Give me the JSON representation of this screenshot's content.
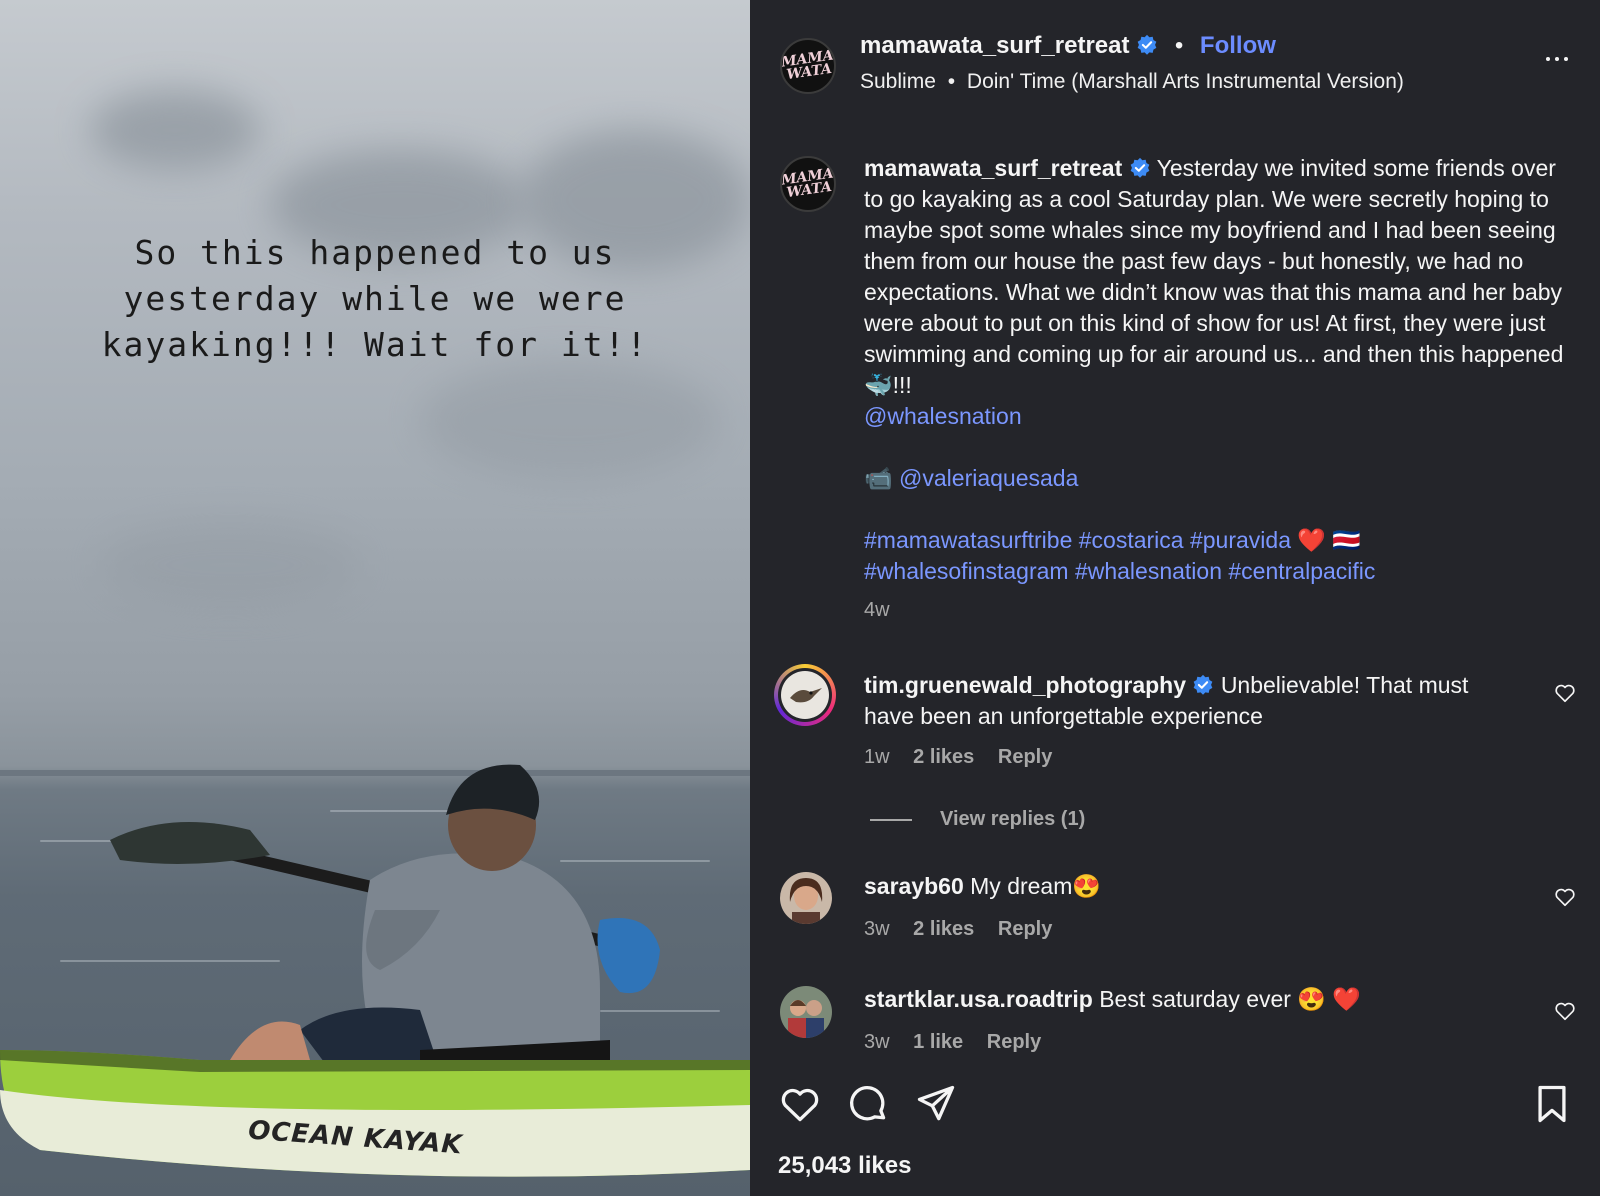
{
  "media": {
    "overlay_text": "So this happened to us yesterday while we were kayaking!!! Wait for it!!",
    "kayak_brand": "OCEAN KAYAK"
  },
  "header": {
    "username": "mamawata_surf_retreat",
    "separator": "•",
    "follow_label": "Follow",
    "artist": "Sublime",
    "song": "Doin' Time (Marshall Arts Instrumental Version)",
    "avatar_logo": "MAMA WATA"
  },
  "caption": {
    "username": "mamawata_surf_retreat",
    "text": "Yesterday we invited some friends over to go kayaking as a cool Saturday plan. We were secretly hoping to maybe spot some whales since my boyfriend and I had been seeing them from our house the past few days - but honestly, we had no expectations. What we didn’t know was that this mama and her baby were about to put on this kind of show for us! At first, they were just swimming and coming up for air around us... and then this happened🐳!!!",
    "mention1": "@whalesnation",
    "camera_emoji": "📹",
    "mention2": "@valeriaquesada",
    "hashtags_line1": "#mamawatasurftribe #costarica #puravida",
    "hashtags_line1_emoji": "❤️ 🇨🇷",
    "hashtags_line2": "#whalesofinstagram #whalesnation #centralpacific",
    "time": "4w"
  },
  "comments": [
    {
      "username": "tim.gruenewald_photography",
      "text": "Unbelievable! That must have been an unforgettable experience",
      "time": "1w",
      "likes": "2 likes",
      "reply_label": "Reply",
      "view_replies": "View replies (1)"
    },
    {
      "username": "sarayb60",
      "text": "My dream😍",
      "time": "3w",
      "likes": "2 likes",
      "reply_label": "Reply"
    },
    {
      "username": "startklar.usa.roadtrip",
      "text": "Best saturday ever 😍 ❤️",
      "time": "3w",
      "likes": "1 like",
      "reply_label": "Reply"
    }
  ],
  "footer": {
    "likes": "25,043 likes"
  },
  "colors": {
    "panel_bg": "#24252a",
    "link": "#7b97ff",
    "follow": "#6c8cff",
    "verified": "#3d8bf5",
    "muted": "#a8a8a8"
  }
}
